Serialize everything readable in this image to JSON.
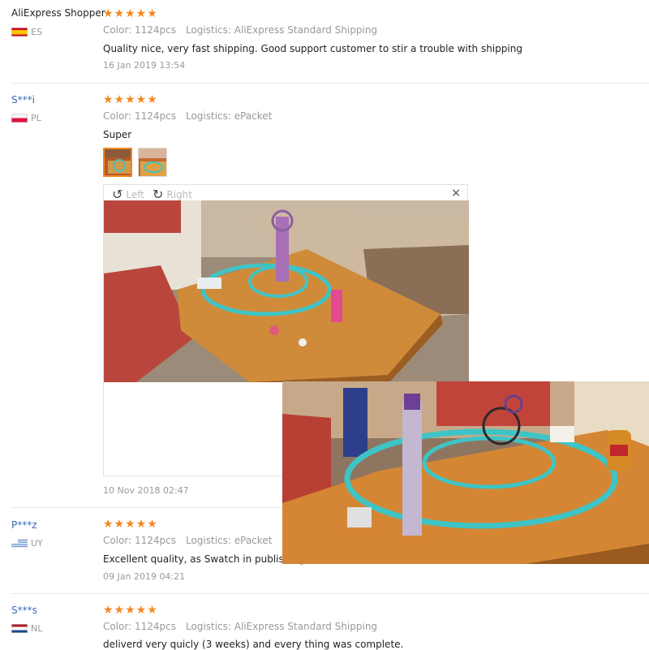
{
  "reviews": [
    {
      "name": "AliExpress Shopper",
      "country": "ES",
      "stars": "★★★★★",
      "color": "Color: 1124pcs",
      "logistics": "Logistics: AliExpress Standard Shipping",
      "text": "Quality nice, very fast shipping. Good support customer to stir a trouble with shipping",
      "date": "16 Jan 2019 13:54"
    },
    {
      "name": "S***i",
      "country": "PL",
      "stars": "★★★★★",
      "color": "Color: 1124pcs",
      "logistics": "Logistics: ePacket",
      "text": "Super",
      "date": "10 Nov 2018 02:47"
    },
    {
      "name": "P***z",
      "country": "UY",
      "stars": "★★★★★",
      "color": "Color: 1124pcs",
      "logistics": "Logistics: ePacket",
      "text": "Excellent quality, as Swatch in publishing.",
      "date": "09 Jan 2019 04:21"
    },
    {
      "name": "S***s",
      "country": "NL",
      "stars": "★★★★★",
      "color": "Color: 1124pcs",
      "logistics": "Logistics: AliExpress Standard Shipping",
      "text": "deliverd very quicly (3 weeks) and every thing was complete.",
      "date": ""
    }
  ],
  "viewer": {
    "left_label": "Left",
    "right_label": "Right",
    "close": "×"
  },
  "colors": {
    "star": "#f5861f",
    "masked_name": "#3a6bb5",
    "muted": "#999999"
  }
}
